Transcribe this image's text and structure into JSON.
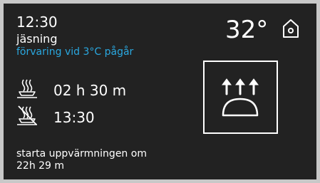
{
  "status": {
    "time": "12:30",
    "program": "jäsning",
    "storage_message": "förvaring vid 3°C pågår",
    "temperature": "32°"
  },
  "settings": {
    "duration": "02 h 30 m",
    "end_time": "13:30"
  },
  "start": {
    "label": "starta uppvärmningen om",
    "value": "22h 29 m"
  },
  "colors": {
    "background": "#222222",
    "text": "#ffffff",
    "accent": "#2aa8e0",
    "frame": "#c8c8c8"
  },
  "icons": {
    "home": "home-icon",
    "duration": "steaming-dish-icon",
    "end_time": "crossed-dish-icon",
    "mode": "dough-proofing-icon"
  }
}
